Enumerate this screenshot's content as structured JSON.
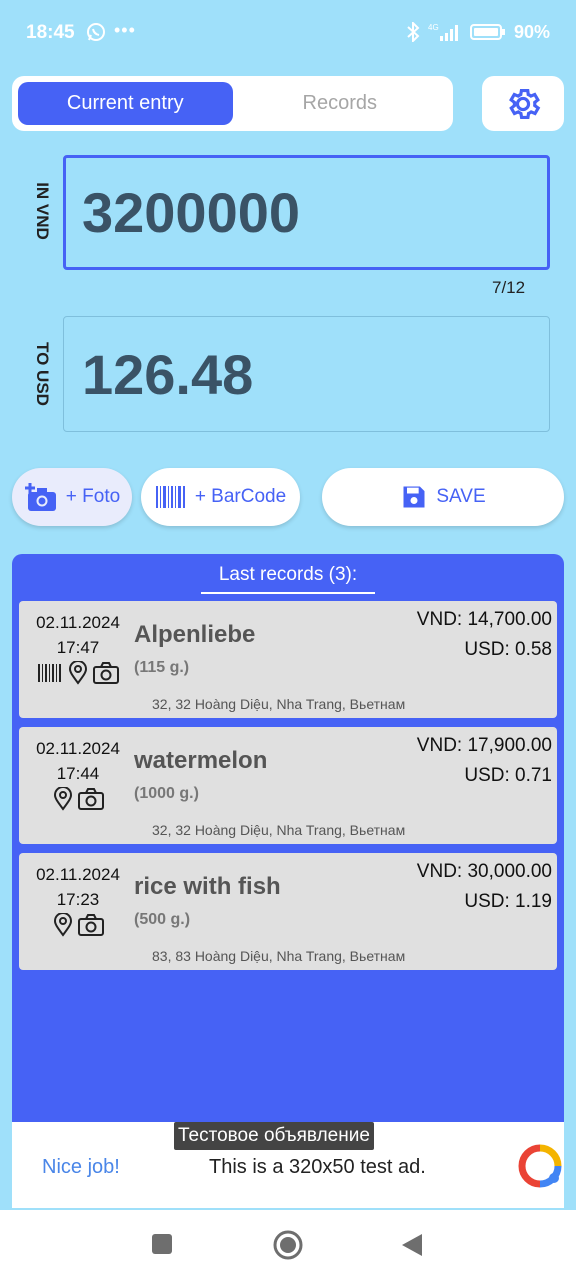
{
  "status_bar": {
    "time": "18:45",
    "dots": "•••",
    "battery": "90%"
  },
  "tabs": {
    "current": "Current entry",
    "records": "Records"
  },
  "input": {
    "label": "IN VND",
    "value": "3200000",
    "counter": "7/12"
  },
  "output": {
    "label": "TO USD",
    "value": "126.48"
  },
  "buttons": {
    "foto": "+ Foto",
    "barcode": "+ BarCode",
    "save": "SAVE"
  },
  "records": {
    "title": "Last records (3):",
    "items": [
      {
        "date": "02.11.2024",
        "time": "17:47",
        "name": "Alpenliebe",
        "weight": "(115 g.)",
        "vnd": "VND: 14,700.00",
        "usd": "USD: 0.58",
        "address": "32, 32 Hoàng Diệu, Nha Trang, Вьетнам",
        "icons": [
          "barcode-icon",
          "location-icon",
          "camera-icon"
        ]
      },
      {
        "date": "02.11.2024",
        "time": "17:44",
        "name": "watermelon",
        "weight": "(1000 g.)",
        "vnd": "VND: 17,900.00",
        "usd": "USD: 0.71",
        "address": "32, 32 Hoàng Diệu, Nha Trang, Вьетнам",
        "icons": [
          "location-icon",
          "camera-icon"
        ]
      },
      {
        "date": "02.11.2024",
        "time": "17:23",
        "name": "rice with fish",
        "weight": "(500 g.)",
        "vnd": "VND: 30,000.00",
        "usd": "USD: 1.19",
        "address": "83, 83 Hoàng Diệu, Nha Trang, Вьетнам",
        "icons": [
          "location-icon",
          "camera-icon"
        ]
      }
    ]
  },
  "ad": {
    "tag": "Тестовое объявление",
    "nice": "Nice job!",
    "text": "This is a 320x50 test ad."
  },
  "colors": {
    "accent": "#4662f5",
    "background": "#9fe0fa",
    "card": "#e0e0e0"
  }
}
